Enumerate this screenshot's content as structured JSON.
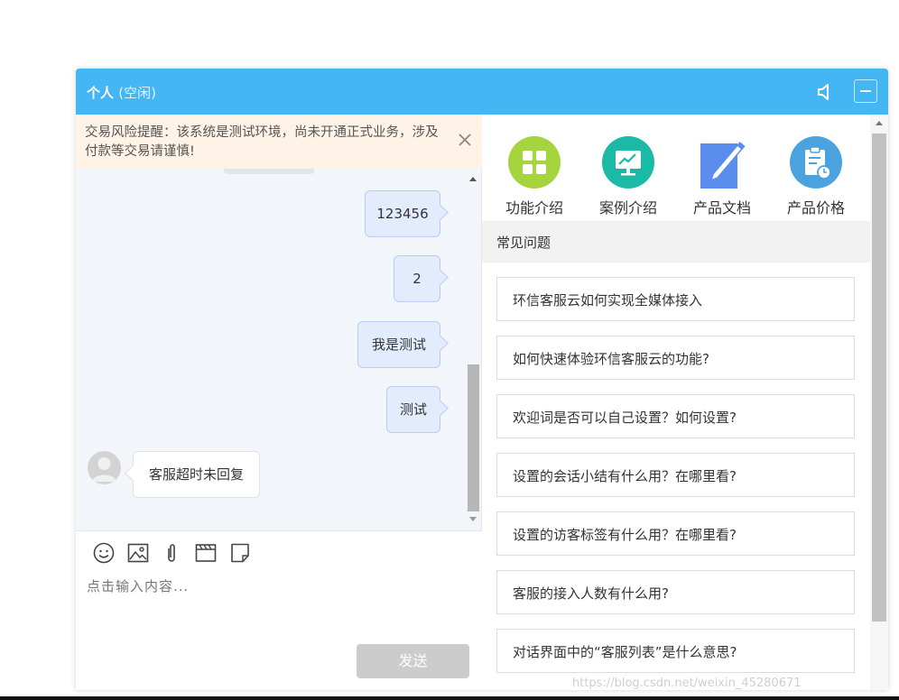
{
  "window": {
    "title": "个人",
    "status": "(空闲)"
  },
  "alert": {
    "text": "交易风险提醒：该系统是测试环境，尚未开通正式业务，涉及付款等交易请谨慎!"
  },
  "messages": {
    "outgoing": [
      "123456",
      "2",
      "我是测试",
      "测试"
    ],
    "incoming": "客服超时未回复"
  },
  "composer": {
    "placeholder": "点击输入内容...",
    "send_label": "发送"
  },
  "shortcuts": [
    {
      "label": "功能介绍",
      "icon": "grid-icon",
      "color": "#a6d43e"
    },
    {
      "label": "案例介绍",
      "icon": "monitor-chart-icon",
      "color": "#1bbaa7"
    },
    {
      "label": "产品文档",
      "icon": "edit-document-icon",
      "color": "#5b8def"
    },
    {
      "label": "产品价格",
      "icon": "clipboard-clock-icon",
      "color": "#4aa3df"
    }
  ],
  "faq": {
    "title": "常见问题",
    "items": [
      "环信客服云如何实现全媒体接入",
      "如何快速体验环信客服云的功能?",
      "欢迎词是否可以自己设置？如何设置?",
      "设置的会话小结有什么用？在哪里看?",
      "设置的访客标签有什么用？在哪里看?",
      "客服的接入人数有什么用?",
      "对话界面中的“客服列表”是什么意思?"
    ]
  },
  "watermark": "https://blog.csdn.net/weixin_45280671",
  "colors": {
    "titlebar": "#45b6f4",
    "alert_bg": "#fff2e6",
    "outgoing_bubble": "#e3ecfd",
    "send_disabled": "#cccccc"
  }
}
